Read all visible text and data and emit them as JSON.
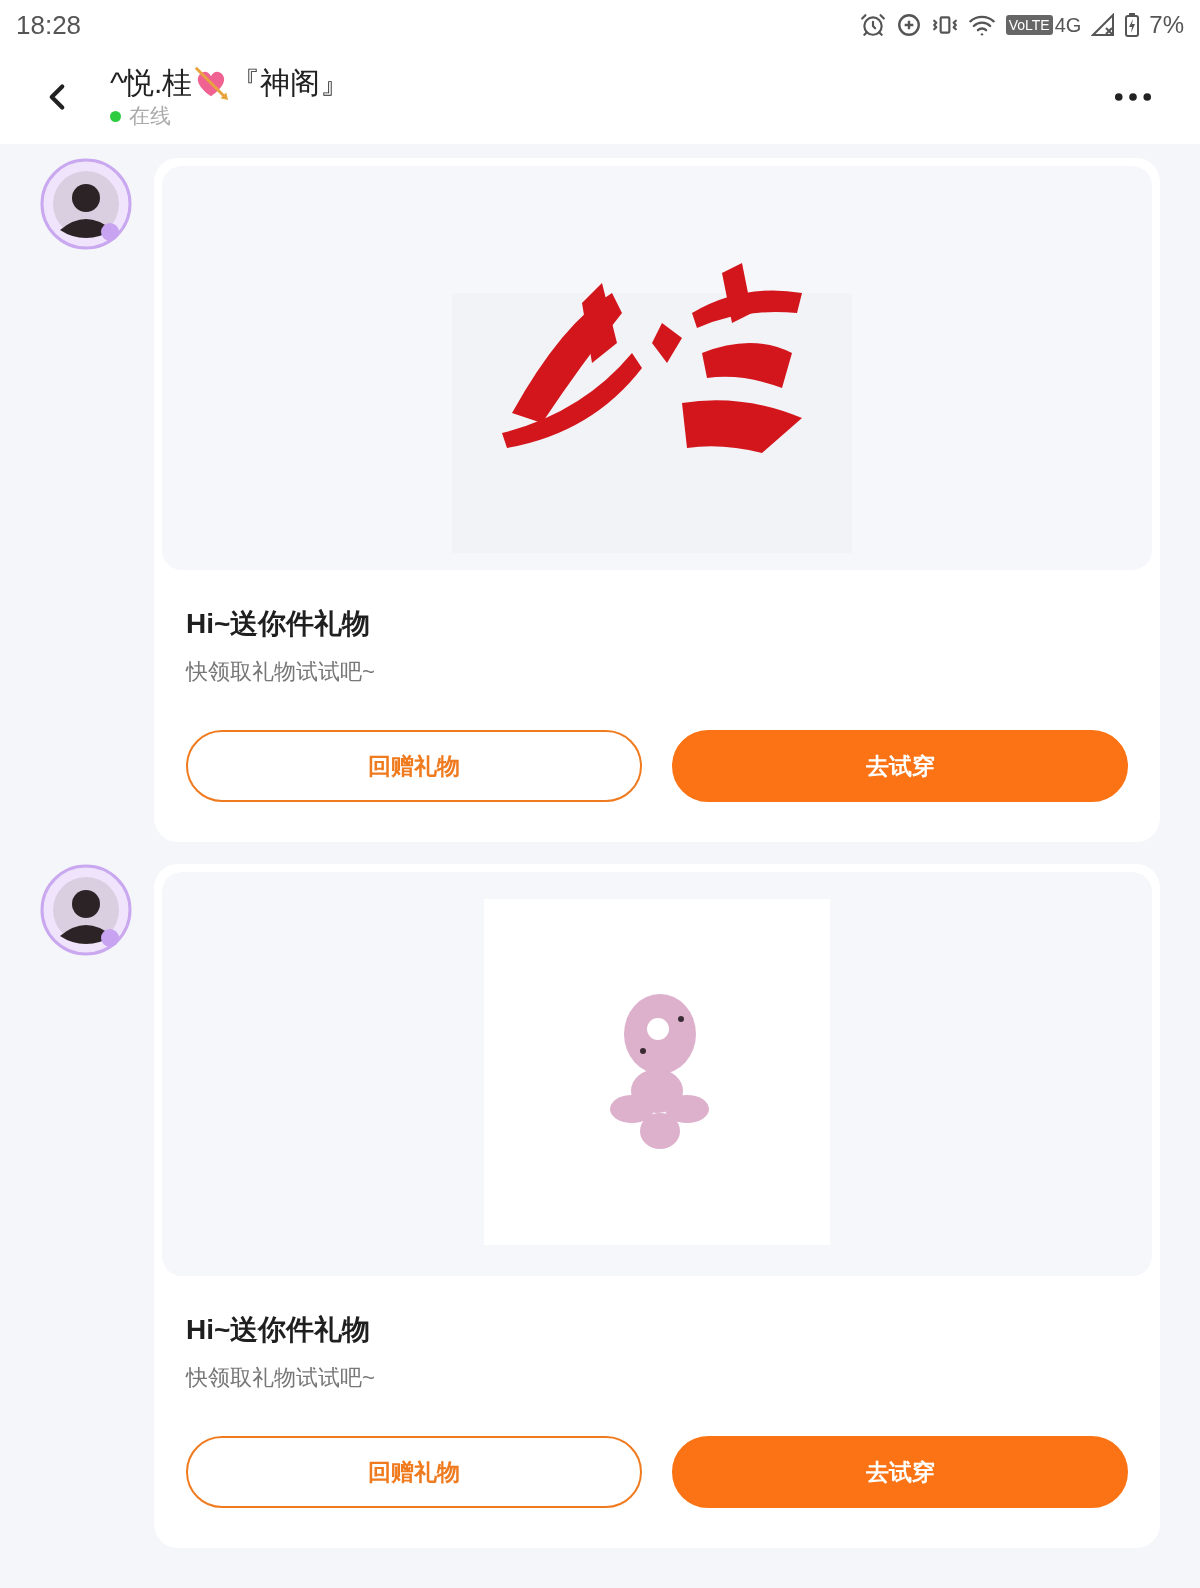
{
  "status_bar": {
    "time": "18:28",
    "network_badge": "VoLTE",
    "network": "4G",
    "battery": "7%"
  },
  "header": {
    "name_start": "^悦.桂",
    "name_end": "『神阁』",
    "status": {
      "label": "在线",
      "online": true
    }
  },
  "messages": [
    {
      "picture": {
        "kind": "calligraphy"
      },
      "title": "Hi~送你件礼物",
      "subtitle": "快领取礼物试试吧~",
      "buttons": [
        {
          "label": "回赠礼物",
          "kind": "outline"
        },
        {
          "label": "去试穿",
          "kind": "filled"
        }
      ]
    },
    {
      "picture": {
        "kind": "charm"
      },
      "title": "Hi~送你件礼物",
      "subtitle": "快领取礼物试试吧~",
      "buttons": [
        {
          "label": "回赠礼物",
          "kind": "outline"
        },
        {
          "label": "去试穿",
          "kind": "filled"
        }
      ]
    }
  ]
}
